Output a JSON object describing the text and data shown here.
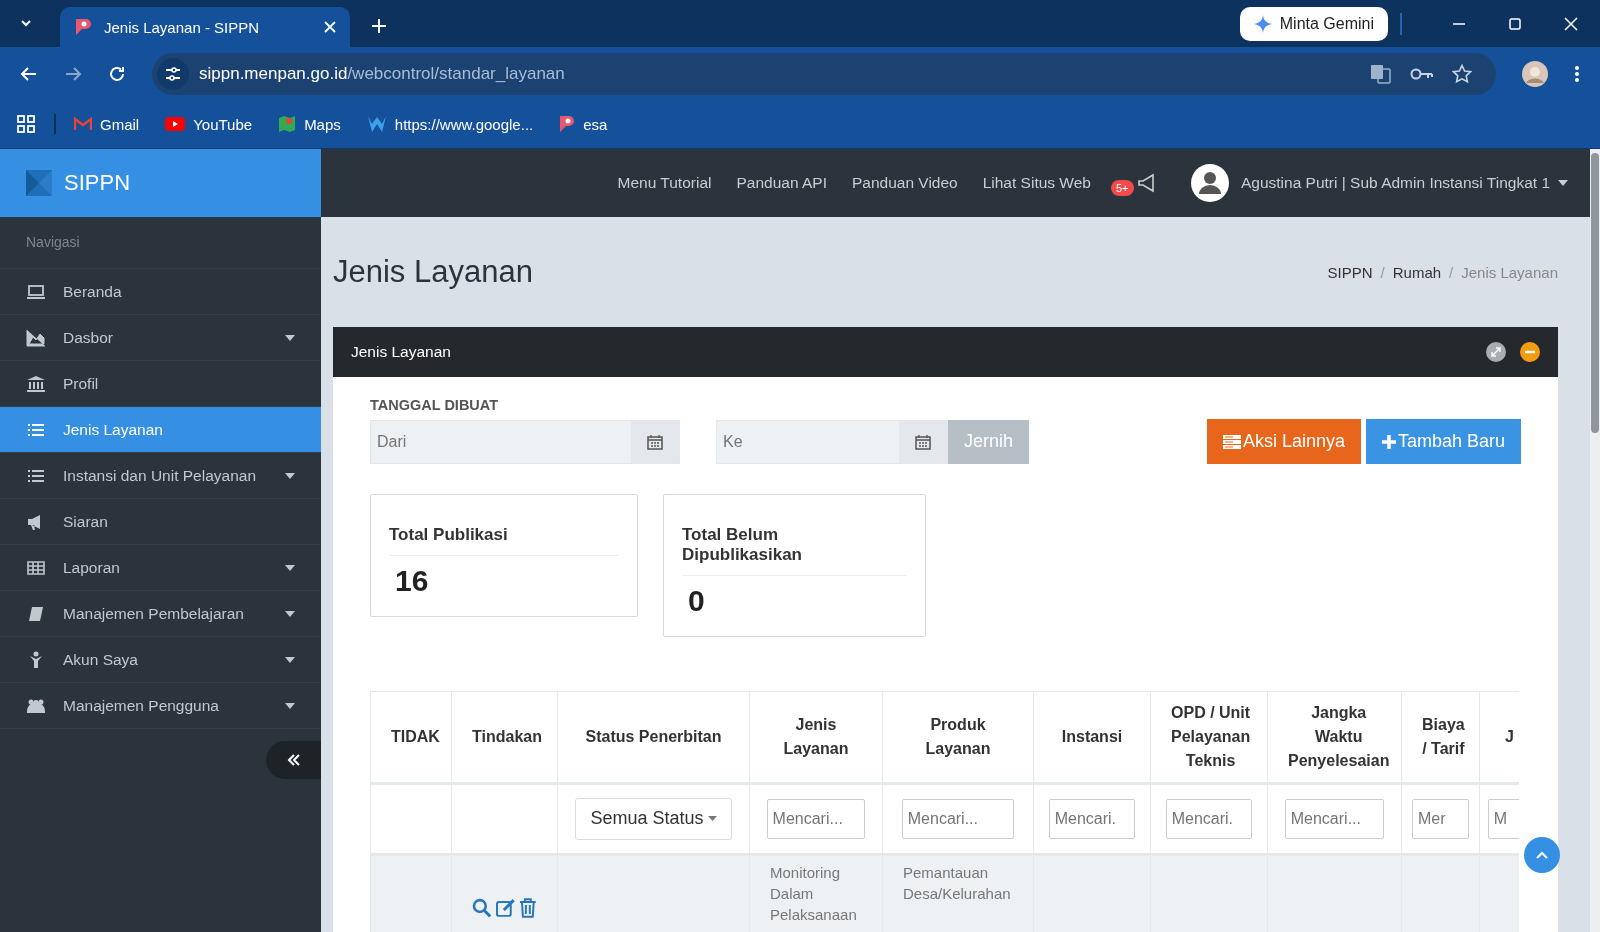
{
  "browser": {
    "tabs": [
      {
        "title": "Jenis Layanan - SIPPN",
        "selected": true
      }
    ],
    "gemini_button": "Minta Gemini",
    "url": {
      "host": "sippn.menpan.go.id",
      "path": "/webcontrol/standar_layanan"
    },
    "bookmarks": [
      {
        "label": "Gmail"
      },
      {
        "label": "YouTube"
      },
      {
        "label": "Maps"
      },
      {
        "label": "https://www.google..."
      },
      {
        "label": "esa"
      }
    ]
  },
  "sidebar": {
    "brand": "SIPPN",
    "section": "Navigasi",
    "items": [
      {
        "label": "Beranda",
        "submenu": false,
        "selected": false
      },
      {
        "label": "Dasbor",
        "submenu": true,
        "selected": false
      },
      {
        "label": "Profil",
        "submenu": false,
        "selected": false
      },
      {
        "label": "Jenis Layanan",
        "submenu": false,
        "selected": true
      },
      {
        "label": "Instansi dan Unit Pelayanan",
        "submenu": true,
        "selected": false
      },
      {
        "label": "Siaran",
        "submenu": false,
        "selected": false
      },
      {
        "label": "Laporan",
        "submenu": true,
        "selected": false
      },
      {
        "label": "Manajemen Pembelajaran",
        "submenu": true,
        "selected": false
      },
      {
        "label": "Akun Saya",
        "submenu": true,
        "selected": false
      },
      {
        "label": "Manajemen Pengguna",
        "submenu": true,
        "selected": false
      }
    ]
  },
  "topnav": {
    "links": [
      "Menu Tutorial",
      "Panduan API",
      "Panduan Video",
      "Lihat Situs Web"
    ],
    "notification_badge": "5+",
    "user": "Agustina Putri | Sub Admin Instansi Tingkat 1"
  },
  "page": {
    "title": "Jenis Layanan",
    "breadcrumb": [
      {
        "label": "SIPPN",
        "selected": false
      },
      {
        "label": "Rumah",
        "separator": "/",
        "selected": false
      },
      {
        "label": "Jenis Layanan",
        "separator": "/",
        "selected": true
      }
    ]
  },
  "panel": {
    "title": "Jenis Layanan",
    "filter_label": "TANGGAL DIBUAT",
    "from_placeholder": "Dari",
    "to_placeholder": "Ke",
    "clear_button": "Jernih",
    "actions_button": "Aksi Lainnya",
    "add_button": "Tambah Baru",
    "stats": [
      {
        "label": "Total Publikasi",
        "value": "16"
      },
      {
        "label": "Total Belum Dipublikasikan",
        "value": "0"
      }
    ],
    "table": {
      "columns": [
        "TIDAK",
        "Tindakan",
        "Status Penerbitan",
        "Jenis Layanan",
        "Produk Layanan",
        "Instansi",
        "OPD / Unit Pelayanan Teknis",
        "Jangka Waktu Penyelesaian",
        "Biaya / Tarif",
        "J"
      ],
      "filters": [
        {
          "kind": "none"
        },
        {
          "kind": "none"
        },
        {
          "kind": "select",
          "value": "Semua Status"
        },
        {
          "kind": "search",
          "placeholder": "Mencari..."
        },
        {
          "kind": "search",
          "placeholder": "Mencari..."
        },
        {
          "kind": "search",
          "placeholder": "Mencari."
        },
        {
          "kind": "search",
          "placeholder": "Mencari."
        },
        {
          "kind": "search",
          "placeholder": "Mencari..."
        },
        {
          "kind": "search",
          "placeholder": "Mer"
        },
        {
          "kind": "search",
          "placeholder": "M"
        }
      ],
      "rows": [
        {
          "cells": [
            {
              "kind": "empty"
            },
            {
              "kind": "actions"
            },
            {
              "kind": "empty"
            },
            {
              "kind": "text",
              "text": "Monitoring Dalam Pelaksanaan"
            },
            {
              "kind": "text",
              "text": "Pemantauan Desa/Kelurahan"
            },
            {
              "kind": "empty"
            },
            {
              "kind": "empty"
            },
            {
              "kind": "empty"
            },
            {
              "kind": "empty"
            },
            {
              "kind": "empty"
            }
          ]
        }
      ]
    }
  }
}
